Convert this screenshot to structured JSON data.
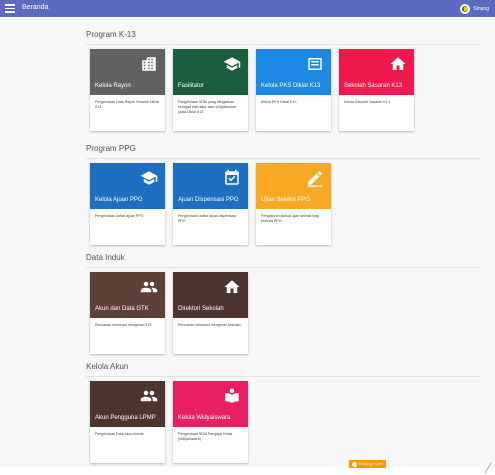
{
  "topbar": {
    "title": "Beranda",
    "user": "Sinung",
    "color": "#5c6bc0"
  },
  "sections": [
    {
      "title": "Program K-13",
      "cards": [
        {
          "title": "Kelola Rayon",
          "desc": "Pengelolaan Data Rayon Sekolah Diklat K13",
          "color": "#616161",
          "icon": "building-icon"
        },
        {
          "title": "Fasilitator",
          "desc": "Pengelolaan SDM yang ditugaskan sebagai Instruktur atau Widyaiswara pada Diklat K13",
          "color": "#1b5e3f",
          "icon": "graduation-cap-icon"
        },
        {
          "title": "Kelola PKS Diklat K13",
          "desc": "Kelola PKS Diklat K13",
          "color": "#1e88e5",
          "icon": "document-icon"
        },
        {
          "title": "Sekolah Sasaran K13",
          "desc": "Kelola Sekolah Sasaran K13",
          "color": "#f0194e",
          "icon": "home-icon"
        }
      ]
    },
    {
      "title": "Program PPG",
      "cards": [
        {
          "title": "Kelola Ajuan PPG",
          "desc": "Pengelolaan daftar ajuan PPG",
          "color": "#1e6fc2",
          "icon": "graduation-cap-icon"
        },
        {
          "title": "Ajuan Dispensasi PPG",
          "desc": "Pengelolaan daftar ajuan dispensasi PPG",
          "color": "#1e6fc2",
          "icon": "calendar-check-icon"
        },
        {
          "title": "Ujian Seleksi PPG",
          "desc": "Pengaturan jadwal ujian seleksi bagi peserta PPG",
          "color": "#f9a825",
          "icon": "pencil-icon"
        }
      ]
    },
    {
      "title": "Data Induk",
      "cards": [
        {
          "title": "Akun dan Data GTK",
          "desc": "Pencarian informasi mengenai GTK",
          "color": "#5d4037",
          "icon": "people-icon"
        },
        {
          "title": "Direktori Sekolah",
          "desc": "Pencarian informasi mengenai Sekolah",
          "color": "#4e342e",
          "icon": "home-icon"
        }
      ]
    },
    {
      "title": "Kelola Akun",
      "cards": [
        {
          "title": "Akun Pengguna LPMP",
          "desc": "Pengelolaan Data Akun Admin",
          "color": "#4e342e",
          "icon": "people-icon"
        },
        {
          "title": "Kelola Widyaiswara",
          "desc": "Pengelolaan SDM Pengajar Kelas (Widyaiswara)",
          "color": "#e91e63",
          "icon": "reader-icon"
        }
      ]
    }
  ],
  "help_button": {
    "label": "Hubungi Kami",
    "color": "#ff9800"
  }
}
